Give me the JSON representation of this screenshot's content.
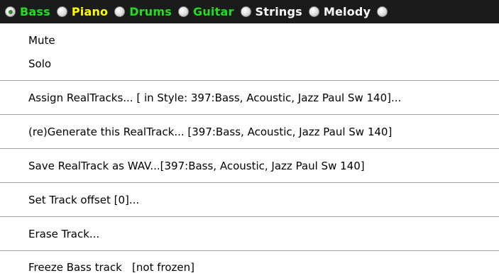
{
  "tracks": [
    {
      "label": "Bass",
      "color": "#22dd22",
      "selected": true
    },
    {
      "label": "Piano",
      "color": "#ffff00",
      "selected": false
    },
    {
      "label": "Drums",
      "color": "#22dd22",
      "selected": false
    },
    {
      "label": "Guitar",
      "color": "#22dd22",
      "selected": false
    },
    {
      "label": "Strings",
      "color": "#ffffff",
      "selected": false
    },
    {
      "label": "Melody",
      "color": "#ffffff",
      "selected": false
    }
  ],
  "menu": {
    "mute": "Mute",
    "solo": "Solo",
    "assign": "Assign RealTracks... [ in Style: 397:Bass, Acoustic, Jazz Paul Sw 140]...",
    "regenerate": "(re)Generate this RealTrack... [397:Bass, Acoustic, Jazz Paul Sw 140]",
    "save_wav": "Save RealTrack as WAV...[397:Bass, Acoustic, Jazz Paul Sw 140]",
    "offset": "Set Track offset [0]...",
    "erase": "Erase Track...",
    "freeze": "Freeze Bass track   [not frozen]"
  }
}
